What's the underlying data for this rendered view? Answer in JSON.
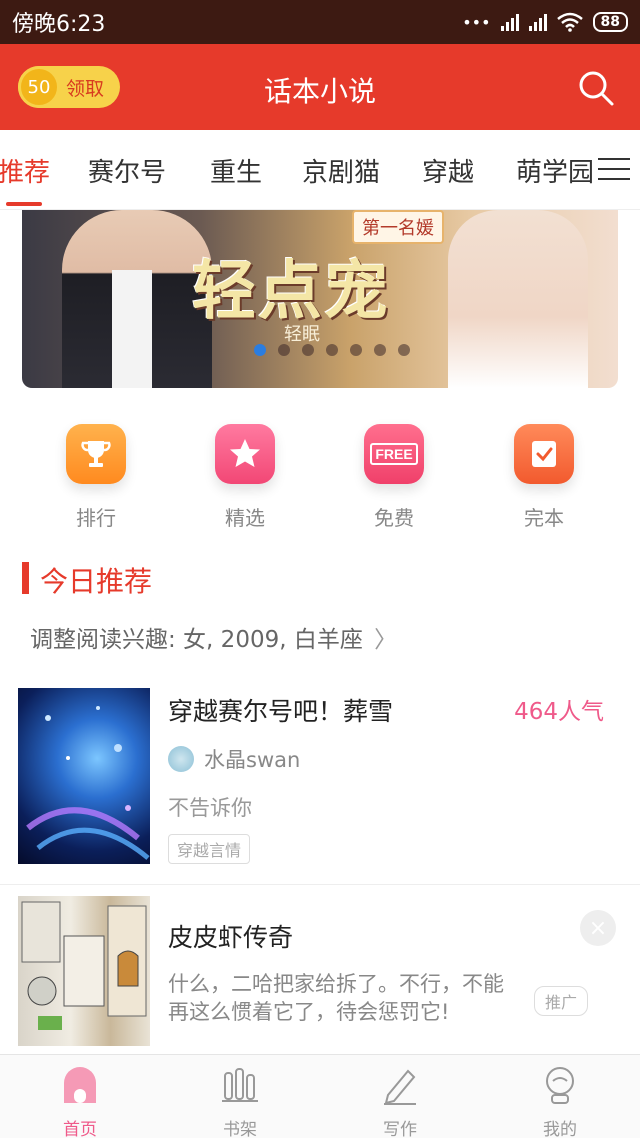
{
  "status_bar": {
    "time": "傍晚6:23",
    "battery": "88"
  },
  "header": {
    "coin_value": "50",
    "coin_label": "领取",
    "title": "话本小说"
  },
  "tabs": [
    "推荐",
    "赛尔号",
    "重生",
    "京剧猫",
    "穿越",
    "萌学园"
  ],
  "banner": {
    "title": "轻点宠",
    "tag": "第一名媛",
    "author": "轻眠"
  },
  "quick_nav": [
    {
      "label": "排行",
      "icon": "trophy-icon"
    },
    {
      "label": "精选",
      "icon": "star-icon"
    },
    {
      "label": "免费",
      "icon": "free-tag-icon",
      "icon_text": "FREE"
    },
    {
      "label": "完本",
      "icon": "check-book-icon"
    }
  ],
  "section": {
    "title": "今日推荐",
    "interest": "调整阅读兴趣: 女, 2009, 白羊座"
  },
  "books": [
    {
      "title": "穿越赛尔号吧！葬雪",
      "popularity": "464人气",
      "author": "水晶swan",
      "desc": "不告诉你",
      "tag": "穿越言情"
    },
    {
      "title": "皮皮虾传奇",
      "desc": "什么，二哈把家给拆了。不行，不能再这么惯着它了，待会惩罚它!",
      "promo": "推广"
    }
  ],
  "bottom_nav": [
    {
      "label": "首页",
      "icon": "home-icon",
      "active": true
    },
    {
      "label": "书架",
      "icon": "bookshelf-icon"
    },
    {
      "label": "写作",
      "icon": "pen-icon"
    },
    {
      "label": "我的",
      "icon": "profile-icon"
    }
  ],
  "colors": {
    "brand_red": "#e63a2b",
    "pink": "#ef5a8a",
    "status_bar": "#3d1a12"
  }
}
